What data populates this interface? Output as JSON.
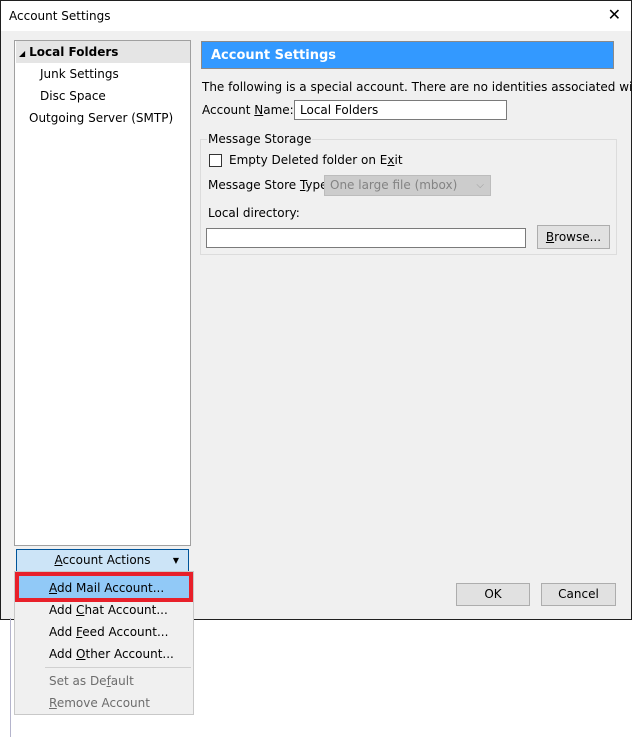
{
  "window": {
    "title": "Account Settings",
    "close_icon": "close-icon"
  },
  "tree": {
    "items": [
      {
        "label": "Local Folders",
        "selected": true,
        "expanded": true
      },
      {
        "label": "Junk Settings"
      },
      {
        "label": "Disc Space"
      },
      {
        "label": "Outgoing Server (SMTP)"
      }
    ]
  },
  "panel": {
    "header": "Account Settings",
    "description": "The following is a special account. There are no identities associated with it.",
    "account_name_label_pre": "Account ",
    "account_name_label_key": "N",
    "account_name_label_post": "ame:",
    "account_name_value": "Local Folders",
    "storage": {
      "legend": "Message Storage",
      "empty_deleted_pre": "Empty Deleted folder on E",
      "empty_deleted_key": "x",
      "empty_deleted_post": "it",
      "empty_deleted_checked": false,
      "store_type_pre": "Message Store ",
      "store_type_key": "T",
      "store_type_post": "ype:",
      "store_type_value": "One large file (mbox)",
      "local_dir_label": "Local directory:",
      "local_dir_value": "",
      "browse_key": "B",
      "browse_post": "rowse..."
    }
  },
  "buttons": {
    "ok": "OK",
    "cancel": "Cancel"
  },
  "account_actions": {
    "label_key": "A",
    "label_post": "ccount Actions",
    "menu": [
      {
        "pre": "",
        "key": "A",
        "post": "dd Mail Account...",
        "highlighted": true,
        "enabled": true
      },
      {
        "pre": "Add ",
        "key": "C",
        "post": "hat Account...",
        "enabled": true
      },
      {
        "pre": "Add ",
        "key": "F",
        "post": "eed Account...",
        "enabled": true
      },
      {
        "pre": "Add ",
        "key": "O",
        "post": "ther Account...",
        "enabled": true
      },
      {
        "pre": "Set as De",
        "key": "f",
        "post": "ault",
        "enabled": false
      },
      {
        "pre": "",
        "key": "R",
        "post": "emove Account",
        "enabled": false
      }
    ]
  },
  "colors": {
    "header_bg": "#3399ff",
    "highlight_border": "#e8202a",
    "menu_highlight": "#91c9f7",
    "actions_bg": "#cce4f7"
  }
}
